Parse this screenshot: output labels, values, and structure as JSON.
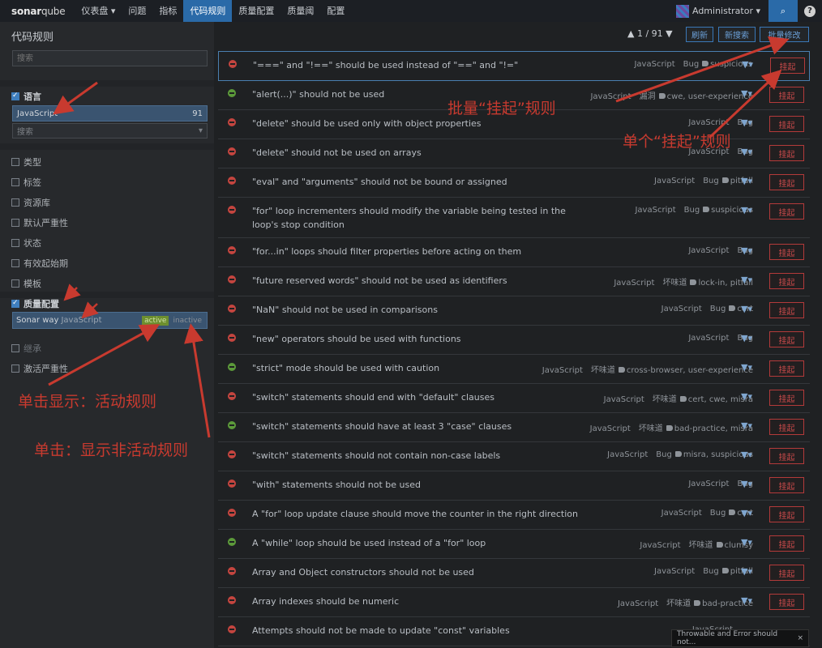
{
  "nav": {
    "logo_a": "sonar",
    "logo_b": "qube",
    "items": [
      "仪表盘 ▾",
      "问题",
      "指标",
      "代码规则",
      "质量配置",
      "质量阈",
      "配置"
    ],
    "user": "Administrator ▾",
    "search_icon": "⌕",
    "help": "?"
  },
  "sidebar": {
    "title": "代码规则",
    "search_placeholder": "搜索",
    "language": {
      "label": "语言",
      "value": "JavaScript",
      "count": "91",
      "search": "搜索"
    },
    "facets": [
      "类型",
      "标签",
      "资源库",
      "默认严重性",
      "状态",
      "有效起始期",
      "模板"
    ],
    "quality_profile": {
      "label": "质量配置",
      "name": "Sonar way",
      "lang": "JavaScript",
      "active": "active",
      "inactive": "inactive"
    },
    "after": [
      "继承",
      "激活严重性"
    ]
  },
  "toolbar": {
    "pager": "▲ 1 / 91 ▼",
    "refresh": "刷新",
    "new_search": "新搜索",
    "bulk_change": "批量修改"
  },
  "rules": [
    {
      "name": "\"===\" and \"!==\" should be used instead of \"==\" and \"!=\"",
      "lang": "JavaScript",
      "type": "Bug",
      "tags": "suspicious",
      "sev": "major"
    },
    {
      "name": "\"alert(...)\" should not be used",
      "lang": "JavaScript",
      "type": "漏洞",
      "tags": "cwe, user-experience",
      "sev": "minor"
    },
    {
      "name": "\"delete\" should be used only with object properties",
      "lang": "JavaScript",
      "type": "Bug",
      "tags": "",
      "sev": "critical"
    },
    {
      "name": "\"delete\" should not be used on arrays",
      "lang": "JavaScript",
      "type": "Bug",
      "tags": "",
      "sev": "critical"
    },
    {
      "name": "\"eval\" and \"arguments\" should not be bound or assigned",
      "lang": "JavaScript",
      "type": "Bug",
      "tags": "pitfall",
      "sev": "critical"
    },
    {
      "name": "\"for\" loop incrementers should modify the variable being tested in the loop's stop condition",
      "lang": "JavaScript",
      "type": "Bug",
      "tags": "suspicious",
      "sev": "critical"
    },
    {
      "name": "\"for...in\" loops should filter properties before acting on them",
      "lang": "JavaScript",
      "type": "Bug",
      "tags": "",
      "sev": "major"
    },
    {
      "name": "\"future reserved words\" should not be used as identifiers",
      "lang": "JavaScript",
      "type": "坏味道",
      "tags": "lock-in, pitfall",
      "sev": "critical"
    },
    {
      "name": "\"NaN\" should not be used in comparisons",
      "lang": "JavaScript",
      "type": "Bug",
      "tags": "cert",
      "sev": "blocker"
    },
    {
      "name": "\"new\" operators should be used with functions",
      "lang": "JavaScript",
      "type": "Bug",
      "tags": "",
      "sev": "critical"
    },
    {
      "name": "\"strict\" mode should be used with caution",
      "lang": "JavaScript",
      "type": "坏味道",
      "tags": "cross-browser, user-experience",
      "sev": "info"
    },
    {
      "name": "\"switch\" statements should end with \"default\" clauses",
      "lang": "JavaScript",
      "type": "坏味道",
      "tags": "cert, cwe, misra",
      "sev": "critical"
    },
    {
      "name": "\"switch\" statements should have at least 3 \"case\" clauses",
      "lang": "JavaScript",
      "type": "坏味道",
      "tags": "bad-practice, misra",
      "sev": "minor"
    },
    {
      "name": "\"switch\" statements should not contain non-case labels",
      "lang": "JavaScript",
      "type": "Bug",
      "tags": "misra, suspicious",
      "sev": "critical"
    },
    {
      "name": "\"with\" statements should not be used",
      "lang": "JavaScript",
      "type": "Bug",
      "tags": "",
      "sev": "critical"
    },
    {
      "name": "A \"for\" loop update clause should move the counter in the right direction",
      "lang": "JavaScript",
      "type": "Bug",
      "tags": "cert",
      "sev": "blocker"
    },
    {
      "name": "A \"while\" loop should be used instead of a \"for\" loop",
      "lang": "JavaScript",
      "type": "坏味道",
      "tags": "clumsy",
      "sev": "minor"
    },
    {
      "name": "Array and Object constructors should not be used",
      "lang": "JavaScript",
      "type": "Bug",
      "tags": "pitfall",
      "sev": "critical"
    },
    {
      "name": "Array indexes should be numeric",
      "lang": "JavaScript",
      "type": "坏味道",
      "tags": "bad-practice",
      "sev": "critical"
    },
    {
      "name": "Attempts should not be made to update \"const\" variables",
      "lang": "JavaScript",
      "type": "",
      "tags": "",
      "sev": "blocker"
    }
  ],
  "suspend_label": "挂起",
  "annotations": {
    "bulk": "批量“挂起”规则",
    "single": "单个“挂起”规则",
    "active": "单击显示：活动规则",
    "inactive": "单击：显示非活动规则"
  },
  "toast": "Throwable and Error should not...",
  "toast_close": "×"
}
